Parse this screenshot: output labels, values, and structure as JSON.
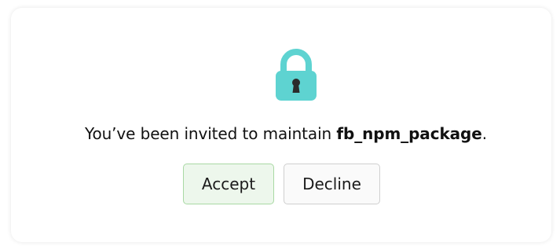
{
  "dialog": {
    "message_prefix": "You’ve been invited to maintain ",
    "package_name": "fb_npm_package",
    "message_suffix": ".",
    "lock_icon": "lock-icon"
  },
  "buttons": {
    "accept_label": "Accept",
    "decline_label": "Decline"
  },
  "colors": {
    "lock_body": "#5ed3d1",
    "lock_shackle": "#5ed3d1",
    "keyhole": "#2b2b2b",
    "accept_bg": "#edf7ec",
    "accept_border": "#a9d9a4",
    "decline_bg": "#fafafa",
    "decline_border": "#cfcfcf"
  }
}
